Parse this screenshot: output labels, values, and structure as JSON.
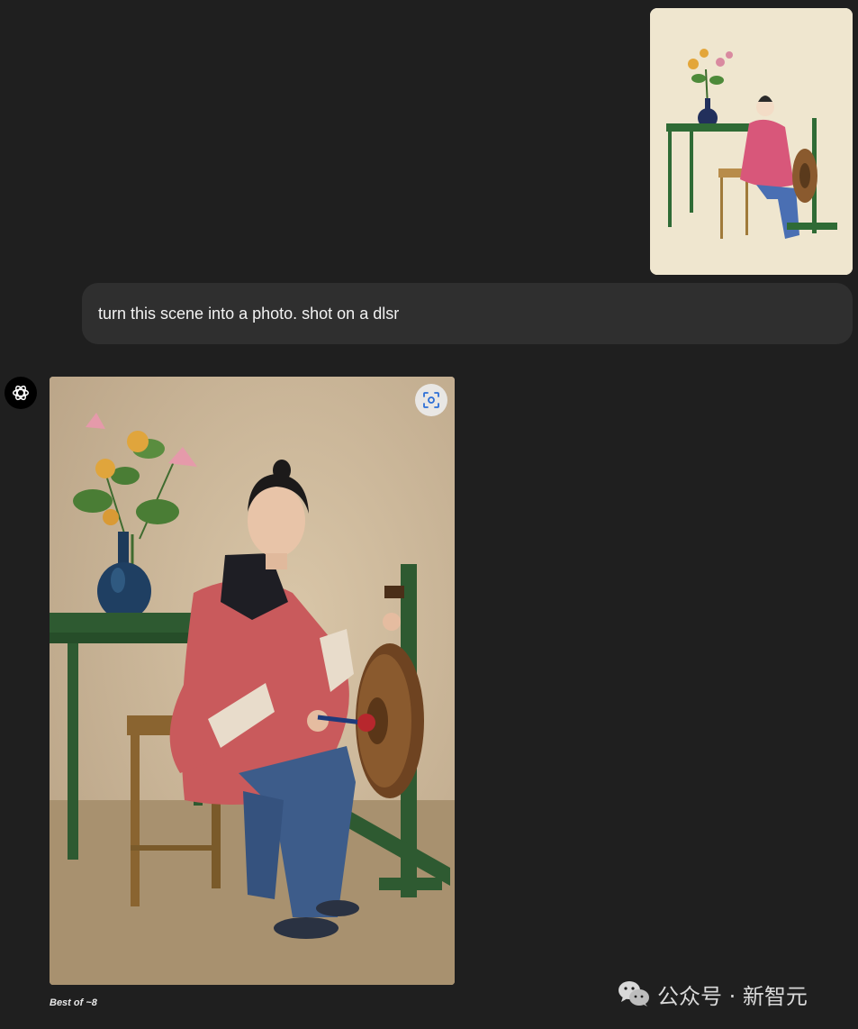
{
  "conversation": {
    "user_message": "turn this scene into a photo. shot on a dlsr",
    "generation_caption": "Best of ~8"
  },
  "icons": {
    "assistant_avatar": "openai-logo-icon",
    "zoom": "image-focus-icon",
    "watermark_logo": "wechat-icon"
  },
  "watermark": {
    "text": "公众号 · 新智元"
  },
  "colors": {
    "background": "#1f1f1f",
    "bubble": "#2f2f2f",
    "text": "#ececec"
  }
}
